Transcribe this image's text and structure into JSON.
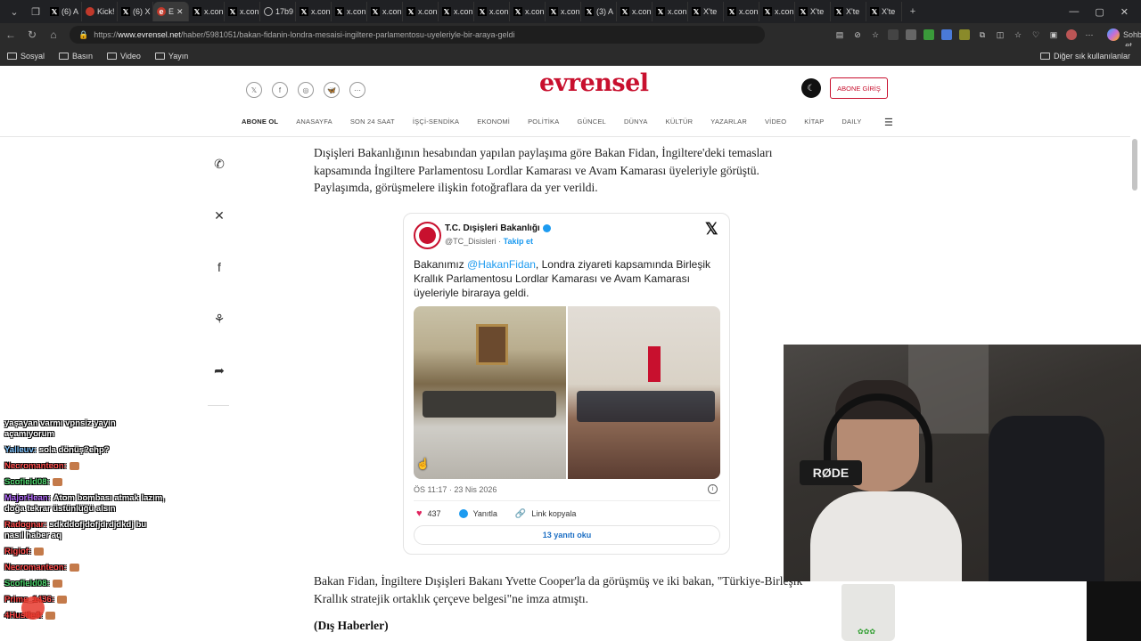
{
  "browser": {
    "tabs": [
      "(6) A",
      "Kick!",
      "(6) X",
      "E",
      "x.con",
      "x.con",
      "17b9",
      "x.con",
      "x.con",
      "x.con",
      "x.con",
      "x.con",
      "x.con",
      "x.con",
      "x.con",
      "(3) A",
      "x.con",
      "x.con",
      "X'te",
      "x.con",
      "x.con",
      "X'te",
      "X'te",
      "X'te"
    ],
    "url_prefix": "https://",
    "url_domain": "www.evrensel.net",
    "url_path": "/haber/5981051/bakan-fidanin-londra-mesaisi-ingiltere-parlamentosu-uyeleriyle-bir-araya-geldi",
    "copilot_label": "Sohbet et",
    "bookmarks": [
      "Sosyal",
      "Basın",
      "Video",
      "Yayın"
    ],
    "bookmarks_right": "Diğer sık kullanılanlar"
  },
  "site": {
    "logo": "evrensel",
    "abone_giris": "ABONE GİRİŞ",
    "menu": [
      "ABONE OL",
      "ANASAYFA",
      "SON 24 SAAT",
      "İŞÇİ-SENDİKA",
      "EKONOMİ",
      "POLİTİKA",
      "GÜNCEL",
      "DÜNYA",
      "KÜLTÜR",
      "YAZARLAR",
      "VİDEO",
      "KİTAP",
      "DAILY"
    ]
  },
  "article": {
    "paragraph1": "Dışişleri Bakanlığının hesabından yapılan paylaşıma göre Bakan Fidan, İngiltere'deki temasları kapsamında İngiltere Parlamentosu Lordlar Kamarası ve Avam Kamarası üyeleriyle görüştü. Paylaşımda, görüşmelere ilişkin fotoğraflara da yer verildi.",
    "paragraph2": "Bakan Fidan, İngiltere Dışişleri Bakanı Yvette Cooper'la da görüşmüş ve iki bakan, \"Türkiye-Birleşik Krallık stratejik ortaklık çerçeve belgesi\"ne imza atmıştı.",
    "source": "(Dış Haberler)"
  },
  "tweet": {
    "name": "T.C. Dışişleri Bakanlığı",
    "handle": "@TC_Disisleri",
    "separator": " · ",
    "follow": "Takip et",
    "text_before": "Bakanımız ",
    "mention": "@HakanFidan",
    "text_after": ", Londra ziyareti kapsamında Birleşik Krallık Parlamentosu Lordlar Kamarası ve Avam Kamarası üyeleriyle biraraya geldi.",
    "time": "ÖS 11:17 · 23 Nis 2026",
    "likes": "437",
    "reply_label": "Yanıtla",
    "copy_link": "Link kopyala",
    "read_replies": "13 yanıtı oku"
  },
  "stream": {
    "mic_brand": "RØDE",
    "chat": [
      {
        "user": "",
        "msg": "yaşayan varmı vpnsiz yayın açamıyorum",
        "color": "#ffffff"
      },
      {
        "user": "Yalleuv:",
        "msg": "sola dönüş?ehp?",
        "color": "#7fc4ff"
      },
      {
        "user": "Necromanteon:",
        "msg": "",
        "color": "#ff4a4a"
      },
      {
        "user": "Scofield08:",
        "msg": "",
        "color": "#4ad36a"
      },
      {
        "user": "MajorHean:",
        "msg": "Atom bombası atmak lazım, doğa tekrar üstünlüğü alsın",
        "color": "#b66bff"
      },
      {
        "user": "Radognar:",
        "msg": "sdkddofjdofjdrdjdkdj bu nasıl haber aq",
        "color": "#ff4a4a"
      },
      {
        "user": "Rigiof:",
        "msg": "",
        "color": "#ff4a4a"
      },
      {
        "user": "Necromanteon:",
        "msg": "",
        "color": "#ff4a4a"
      },
      {
        "user": "Scofield08:",
        "msg": "",
        "color": "#4ad36a"
      },
      {
        "user": "Prime_1436:",
        "msg": "",
        "color": "#ff4a4a"
      },
      {
        "user": "4Hustle4:",
        "msg": "",
        "color": "#ff4a4a"
      }
    ]
  },
  "colors": {
    "brand": "#c8102e",
    "link": "#1d9bf0"
  }
}
